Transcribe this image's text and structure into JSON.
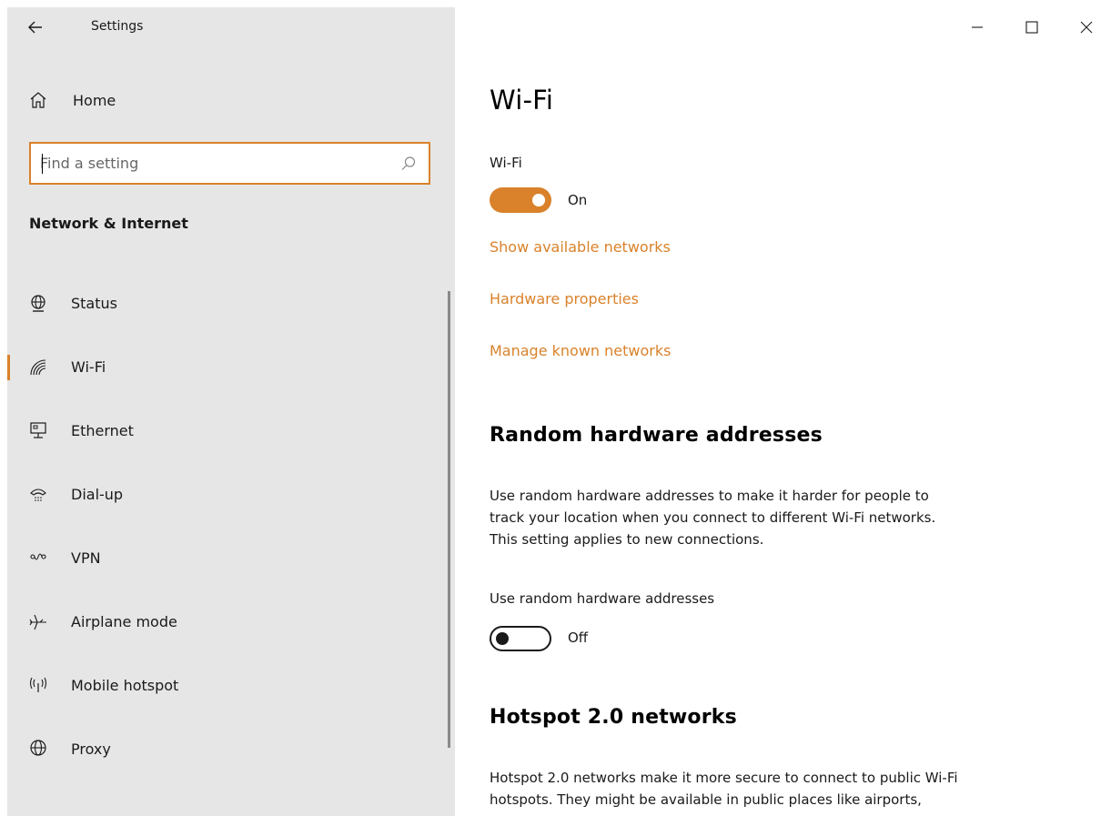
{
  "window": {
    "title": "Settings",
    "controls": [
      "minimize",
      "maximize",
      "close"
    ]
  },
  "sidebar": {
    "home_label": "Home",
    "search": {
      "placeholder": "Find a setting",
      "value": ""
    },
    "section_title": "Network & Internet",
    "active_index": 1,
    "items": [
      {
        "label": "Status",
        "icon": "globe-status-icon"
      },
      {
        "label": "Wi-Fi",
        "icon": "wifi-icon"
      },
      {
        "label": "Ethernet",
        "icon": "ethernet-icon"
      },
      {
        "label": "Dial-up",
        "icon": "dialup-icon"
      },
      {
        "label": "VPN",
        "icon": "vpn-icon"
      },
      {
        "label": "Airplane mode",
        "icon": "airplane-icon"
      },
      {
        "label": "Mobile hotspot",
        "icon": "hotspot-icon"
      },
      {
        "label": "Proxy",
        "icon": "globe-icon"
      }
    ]
  },
  "main": {
    "title": "Wi-Fi",
    "wifi_toggle": {
      "label": "Wi-Fi",
      "state_text": "On",
      "on": true
    },
    "links": [
      "Show available networks",
      "Hardware properties",
      "Manage known networks"
    ],
    "random_hw": {
      "heading": "Random hardware addresses",
      "description_lines": [
        "Use random hardware addresses to make it harder for people to",
        "track your location when you connect to different Wi-Fi networks.",
        "This setting applies to new connections."
      ],
      "toggle_label": "Use random hardware addresses",
      "state_text": "Off",
      "on": false
    },
    "hotspot20": {
      "heading": "Hotspot 2.0 networks",
      "description_lines": [
        "Hotspot 2.0 networks make it more secure to connect to public Wi-Fi",
        "hotspots. They might be available in public places like airports,"
      ]
    }
  },
  "colors": {
    "accent": "#d9822b",
    "sidebar_bg": "#e6e6e6",
    "text": "#1a1a1a"
  }
}
